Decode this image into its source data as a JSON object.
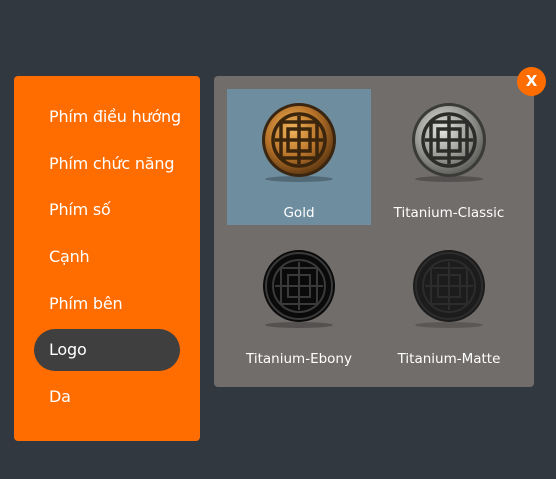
{
  "menu": {
    "items": [
      {
        "label": "Phím điều hướng",
        "active": false
      },
      {
        "label": "Phím chức năng",
        "active": false
      },
      {
        "label": "Phím số",
        "active": false
      },
      {
        "label": "Cạnh",
        "active": false
      },
      {
        "label": "Phím bên",
        "active": false
      },
      {
        "label": "Logo",
        "active": true
      },
      {
        "label": "Da",
        "active": false
      }
    ]
  },
  "logo_options": [
    {
      "label": "Gold",
      "selected": true,
      "color": "#b07a2c"
    },
    {
      "label": "Titanium-Classic",
      "selected": false,
      "color": "#9a9a96"
    },
    {
      "label": "Titanium-Ebony",
      "selected": false,
      "color": "#0b0b0b"
    },
    {
      "label": "Titanium-Matte",
      "selected": false,
      "color": "#1e1e1e"
    }
  ],
  "close_button": {
    "label": "X"
  },
  "colors": {
    "background": "#323840",
    "accent": "#ff6d00",
    "active_item": "#3f3f3f",
    "panel": "#716d6b",
    "selected": "#6e8ea0"
  }
}
